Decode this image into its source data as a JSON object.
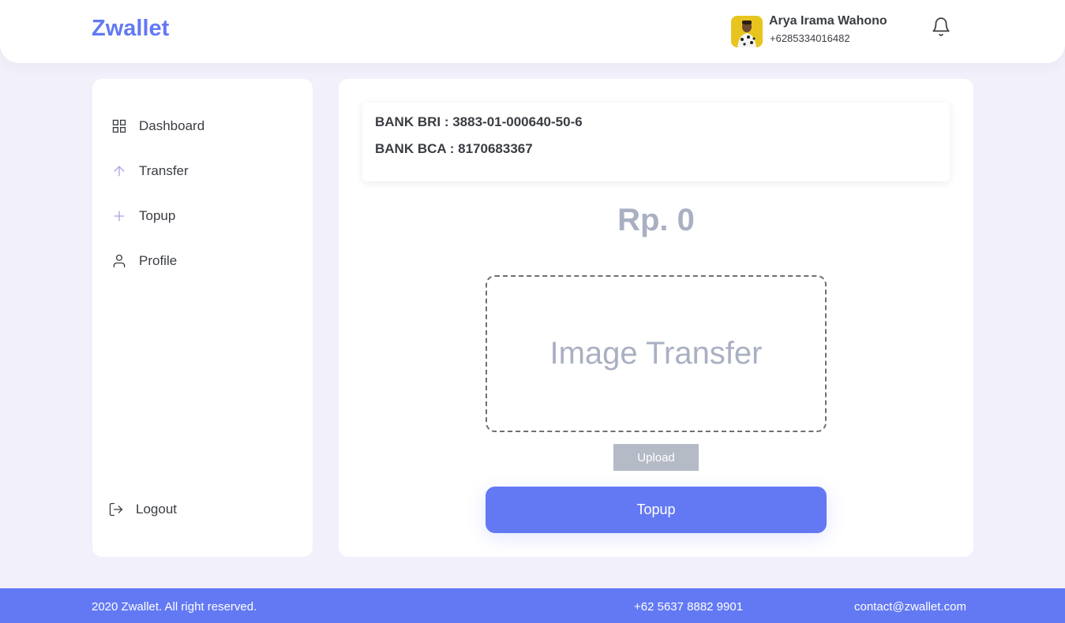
{
  "header": {
    "logo": "Zwallet",
    "user": {
      "name": "Arya Irama Wahono",
      "phone": "+6285334016482",
      "avatar_icon": "user-photo"
    },
    "notification_icon": "bell-icon"
  },
  "sidebar": {
    "items": [
      {
        "label": "Dashboard",
        "icon": "grid-icon"
      },
      {
        "label": "Transfer",
        "icon": "arrow-up-icon"
      },
      {
        "label": "Topup",
        "icon": "plus-icon"
      },
      {
        "label": "Profile",
        "icon": "user-icon"
      }
    ],
    "logout": {
      "label": "Logout",
      "icon": "logout-icon"
    }
  },
  "main": {
    "banks": [
      "BANK BRI : 3883-01-000640-50-6",
      "BANK BCA : 8170683367"
    ],
    "amount": "Rp. 0",
    "image_placeholder": "Image Transfer",
    "upload_label": "Upload",
    "topup_label": "Topup"
  },
  "footer": {
    "copyright": "2020 Zwallet. All right reserved.",
    "phone": "+62 5637 8882 9901",
    "email": "contact@zwallet.com"
  },
  "colors": {
    "accent": "#6379f4",
    "background": "#f2f0fa",
    "muted": "#a9b0c2",
    "upload_button": "#b5bac7"
  }
}
